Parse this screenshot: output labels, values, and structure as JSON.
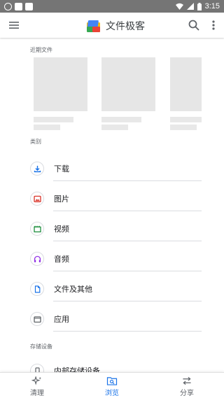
{
  "status_bar": {
    "time": "3:15"
  },
  "app_bar": {
    "title": "文件极客",
    "icons": {
      "menu": "menu-icon",
      "search": "search-icon",
      "more": "more-vert-icon"
    }
  },
  "recent": {
    "heading": "近期文件"
  },
  "categories": {
    "heading": "类别",
    "items": [
      {
        "label": "下载",
        "icon": "download-icon",
        "color": "#1a73e8"
      },
      {
        "label": "图片",
        "icon": "image-icon",
        "color": "#d93025"
      },
      {
        "label": "视频",
        "icon": "video-icon",
        "color": "#1e8e3e"
      },
      {
        "label": "音频",
        "icon": "headphones-icon",
        "color": "#9334e6"
      },
      {
        "label": "文件及其他",
        "icon": "document-icon",
        "color": "#1a73e8"
      },
      {
        "label": "应用",
        "icon": "app-window-icon",
        "color": "#5f6368"
      }
    ]
  },
  "storage": {
    "heading": "存储设备",
    "items": [
      {
        "label": "内部存储设备",
        "icon": "phone-storage-icon"
      }
    ]
  },
  "bottom_nav": {
    "items": [
      {
        "label": "清理",
        "icon": "sparkle-icon",
        "active": false
      },
      {
        "label": "浏览",
        "icon": "browse-folder-icon",
        "active": true
      },
      {
        "label": "分享",
        "icon": "swap-arrows-icon",
        "active": false
      }
    ],
    "active_color": "#1a73e8"
  }
}
